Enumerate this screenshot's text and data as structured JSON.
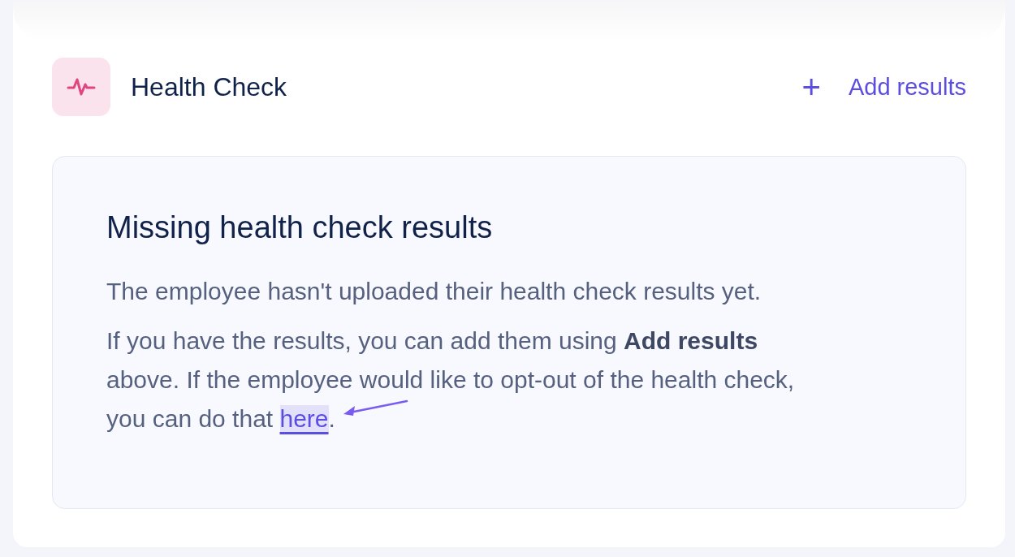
{
  "section": {
    "title": "Health Check",
    "action": {
      "icon": "+",
      "label": "Add results"
    }
  },
  "notice": {
    "heading": "Missing health check results",
    "paragraphs": [
      {
        "text": "The employee hasn't uploaded their health check results yet."
      },
      {
        "text": "If you have the results, you can add them using **Add results** above. If the employee would like to opt-out of the health check, you can do that ",
        "link": "here",
        "after": "."
      }
    ]
  }
}
